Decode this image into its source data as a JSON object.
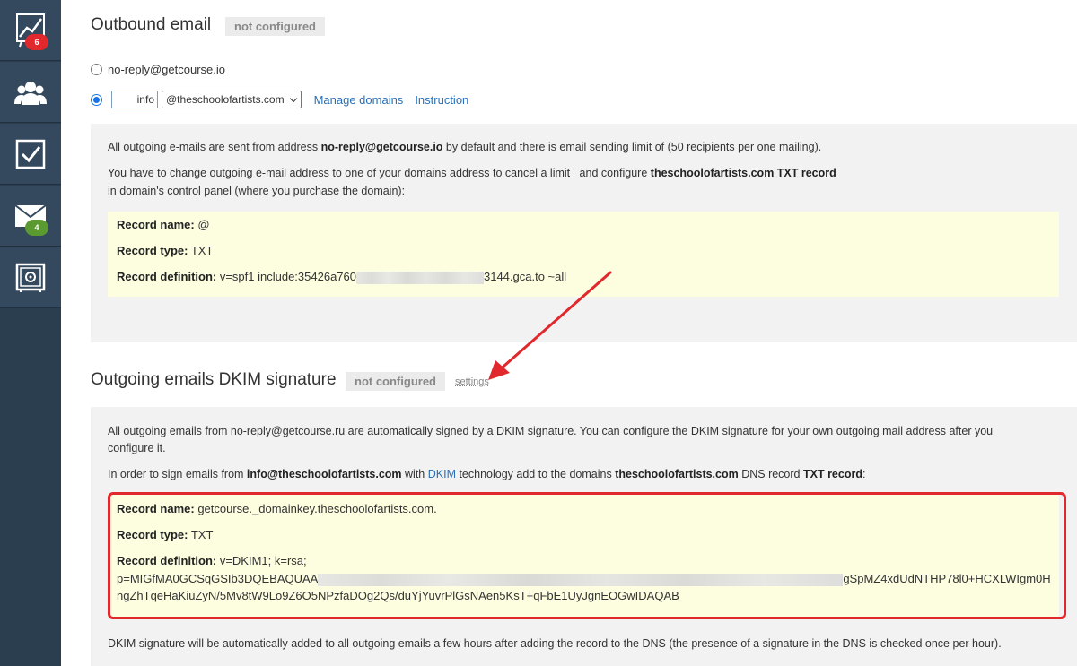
{
  "sidebar": {
    "items": [
      {
        "icon": "chart-icon",
        "badge": "6",
        "badge_color": "#e0282d"
      },
      {
        "icon": "users-icon"
      },
      {
        "icon": "tasks-checkbox-icon"
      },
      {
        "icon": "mail-icon",
        "badge": "4",
        "badge_color": "#5b9a30"
      },
      {
        "icon": "safe-icon"
      }
    ]
  },
  "outbound": {
    "title": "Outbound email",
    "status": "not configured",
    "option_default": "no-reply@getcourse.io",
    "local_part": "info",
    "domain_selected": "@theschoolofartists.com",
    "manage_domains": "Manage domains",
    "instruction": "Instruction",
    "p1_a": "All outgoing e-mails are sent from address ",
    "p1_b": "no-reply@getcourse.io",
    "p1_c": " by default and there is email sending limit of (50 recipients per one mailing).",
    "p2_a": "You have to change outgoing e-mail address to one of your domains address to cancel a limit   and configure ",
    "p2_b": "theschoolofartists.com TXT record",
    "p2_c": "in domain's control panel (where you purchase the domain):",
    "record_name_label": "Record name:",
    "record_name": " @",
    "record_type_label": "Record type:",
    "record_type": " TXT",
    "record_def_label": "Record definition:",
    "record_def_start": " v=spf1 include:35426a760",
    "record_def_end": "3144.gca.to ~all"
  },
  "dkim": {
    "title": "Outgoing emails DKIM signature",
    "status": "not configured",
    "settings": "settings",
    "p1": "All outgoing emails from no-reply@getcourse.ru are automatically signed by a DKIM signature. You can configure the DKIM signature for your own outgoing mail address after you",
    "p1b": "configure it.",
    "p2_a": "In order to sign emails from ",
    "p2_b": "info@theschoolofartists.com",
    "p2_c": " with ",
    "p2_link": "DKIM",
    "p2_d": " technology add to the domains ",
    "p2_e": "theschoolofartists.com",
    "p2_f": " DNS record ",
    "p2_g": "TXT record",
    "p2_h": ":",
    "record_name_label": "Record name:",
    "record_name": " getcourse._domainkey.theschoolofartists.com.",
    "record_type_label": "Record type:",
    "record_type": " TXT",
    "record_def_label": "Record definition:",
    "record_def_1": " v=DKIM1; k=rsa;",
    "record_def_2a": "p=MIGfMA0GCSqGSIb3DQEBAQUAA",
    "record_def_2b": "gSpMZ4xdUdNTHP78l0+HCXLWIgm0H",
    "record_def_3": "ngZhTqeHaKiuZyN/5Mv8tW9Lo9Z6O5NPzfaDOg2Qs/duYjYuvrPlGsNAen5KsT+qFbE1UyJgnEOGwIDAQAB",
    "footer": "DKIM signature will be automatically added to all outgoing emails a few hours after adding the record to the DNS (the presence of a signature in the DNS is checked once per hour)."
  }
}
